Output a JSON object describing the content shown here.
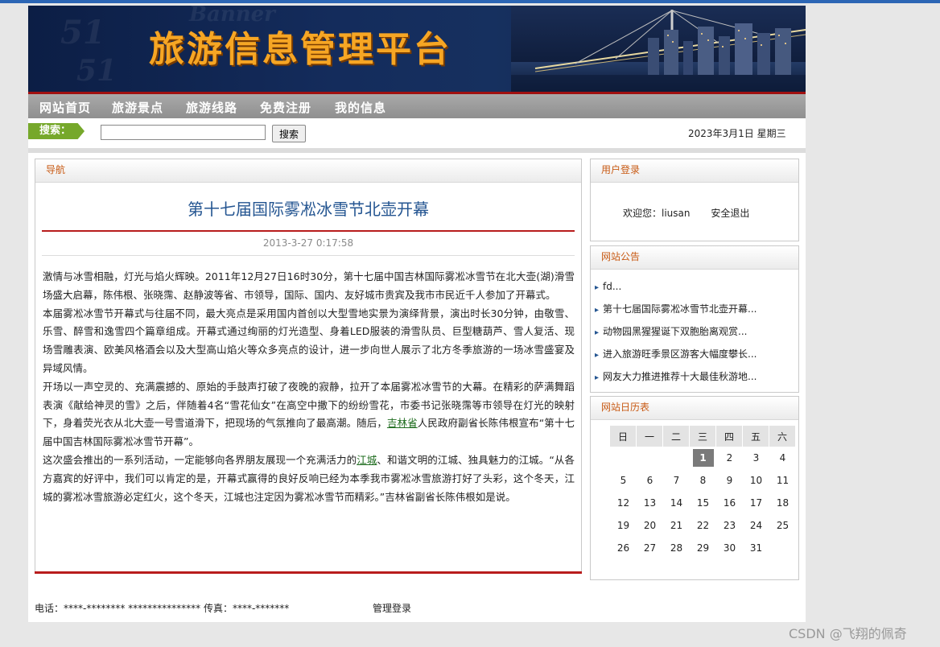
{
  "header": {
    "title": "旅游信息管理平台",
    "watermark": "Banner"
  },
  "nav": {
    "items": [
      "网站首页",
      "旅游景点",
      "旅游线路",
      "免费注册",
      "我的信息"
    ]
  },
  "search": {
    "label": "搜索：",
    "placeholder": "",
    "button": "搜索",
    "date": "2023年3月1日 星期三"
  },
  "main": {
    "heading": "导航",
    "article_title": "第十七届国际雾凇冰雪节北壶开幕",
    "article_date": "2013-3-27 0:17:58",
    "paragraphs": {
      "p1": "激情与冰雪相融，灯光与焰火辉映。2011年12月27日16时30分，第十七届中国吉林国际雾凇冰雪节在北大壶(湖)滑雪场盛大启幕，陈伟根、张晓霈、赵静波等省、市领导，国际、国内、友好城市贵宾及我市市民近千人参加了开幕式。",
      "p2": "本届雾凇冰雪节开幕式与往届不同，最大亮点是采用国内首创以大型雪地实景为演绎背景，演出时长30分钟，由敬雪、乐雪、醉雪和逸雪四个篇章组成。开幕式通过绚丽的灯光造型、身着LED服装的滑雪队员、巨型糖葫芦、雪人复活、现场雪雕表演、欧美风格酒会以及大型高山焰火等众多亮点的设计，进一步向世人展示了北方冬季旅游的一场冰雪盛宴及异域风情。",
      "p3a": "开场以一声空灵的、充满震撼的、原始的手鼓声打破了夜晚的寂静，拉开了本届雾凇冰雪节的大幕。在精彩的萨满舞蹈表演《献给神灵的雪》之后，伴随着4名“雪花仙女”在高空中撒下的纷纷雪花，市委书记张晓霈等市领导在灯光的映射下，身着荧光衣从北大壶一号雪道滑下，把现场的气氛推向了最高潮。随后，",
      "p3link": "吉林省",
      "p3b": "人民政府副省长陈伟根宣布“第十七届中国吉林国际雾凇冰雪节开幕”。",
      "p4a": "这次盛会推出的一系列活动，一定能够向各界朋友展现一个充满活力的",
      "p4link": "江城",
      "p4b": "、和谐文明的江城、独具魅力的江城。“从各方嘉宾的好评中，我们可以肯定的是，开幕式赢得的良好反响已经为本季我市雾凇冰雪旅游打好了头彩，这个冬天，江城的雾凇冰雪旅游必定红火，这个冬天，江城也注定因为雾凇冰雪节而精彩。”吉林省副省长陈伟根如是说。"
    }
  },
  "login": {
    "heading": "用户登录",
    "welcome": "欢迎您：liusan",
    "logout": "安全退出"
  },
  "notice": {
    "heading": "网站公告",
    "items": [
      "fd...",
      "第十七届国际雾凇冰雪节北壶开幕...",
      "动物园黑猩猩诞下双胞胎离观赏...",
      "进入旅游旺季景区游客大幅度攀长...",
      "网友大力推进推荐十大最佳秋游地..."
    ]
  },
  "calendar": {
    "heading": "网站日历表",
    "weekdays": [
      "日",
      "一",
      "二",
      "三",
      "四",
      "五",
      "六"
    ],
    "weeks": [
      [
        "",
        "",
        "",
        "1",
        "2",
        "3",
        "4"
      ],
      [
        "5",
        "6",
        "7",
        "8",
        "9",
        "10",
        "11"
      ],
      [
        "12",
        "13",
        "14",
        "15",
        "16",
        "17",
        "18"
      ],
      [
        "19",
        "20",
        "21",
        "22",
        "23",
        "24",
        "25"
      ],
      [
        "26",
        "27",
        "28",
        "29",
        "30",
        "31",
        ""
      ]
    ],
    "today": "1"
  },
  "footer": {
    "contact": "电话：****-******** *************** 传真：****-*******",
    "admin_login": "管理登录"
  },
  "watermark": "CSDN @飞翔的佩奇",
  "colors": {
    "accent_red": "#b81c1c",
    "title_blue": "#245591",
    "heading_orange": "#c85a14",
    "search_green": "#76a82b",
    "banner_title": "#f6a624"
  }
}
